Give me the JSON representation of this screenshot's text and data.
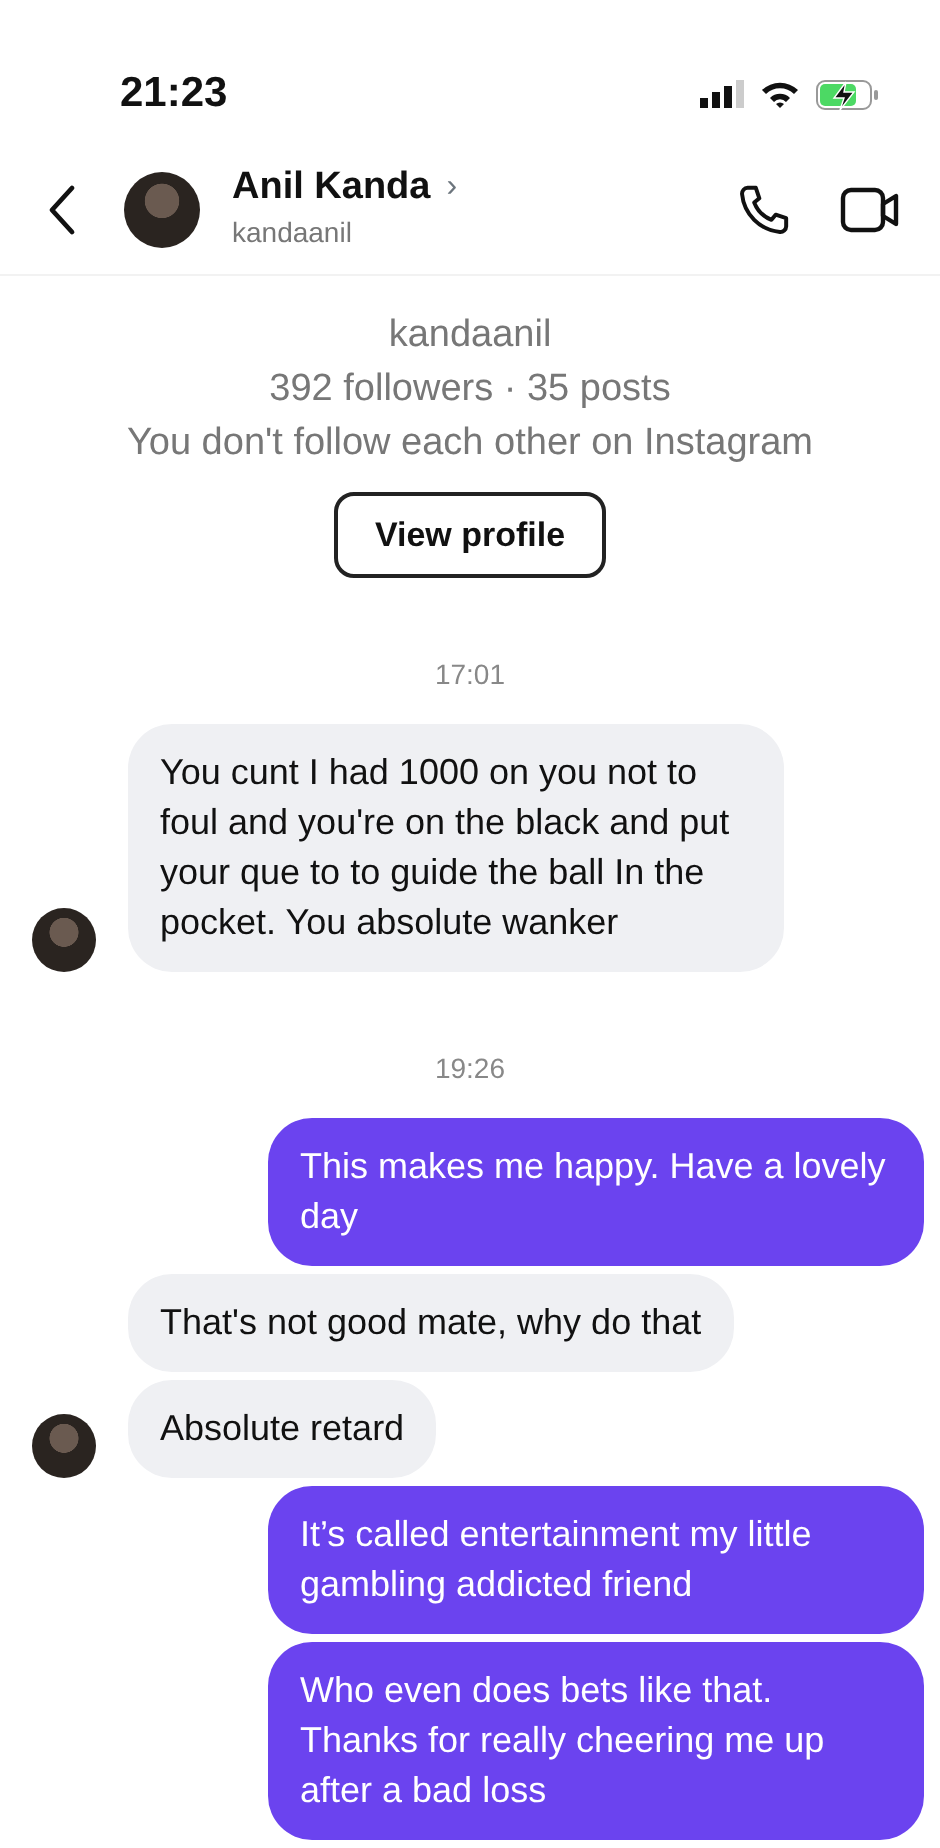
{
  "status_bar": {
    "time": "21:23",
    "charging": true
  },
  "header": {
    "name": "Anil Kanda",
    "chevron": "›",
    "username": "kandaanil"
  },
  "profile": {
    "username": "kandaanil",
    "stats": "392 followers · 35 posts",
    "relation": "You don't follow each other on Instagram",
    "button": "View profile"
  },
  "thread": [
    {
      "kind": "time",
      "text": "17:01"
    },
    {
      "kind": "received",
      "text": "You cunt I had 1000 on you not to foul and you're on the black and put your que to to guide the ball In the pocket. You absolute wanker",
      "avatar": true
    },
    {
      "kind": "time",
      "text": "19:26"
    },
    {
      "kind": "sent",
      "text": "This makes me happy. Have a lovely day"
    },
    {
      "kind": "received",
      "text": "That's not good mate, why do that",
      "avatar": false
    },
    {
      "kind": "received",
      "text": "Absolute retard",
      "avatar": true
    },
    {
      "kind": "sent",
      "text": "It’s called entertainment my little gambling addicted friend"
    },
    {
      "kind": "sent",
      "text": "Who even does bets like that. Thanks for really cheering me up after a bad loss"
    }
  ]
}
